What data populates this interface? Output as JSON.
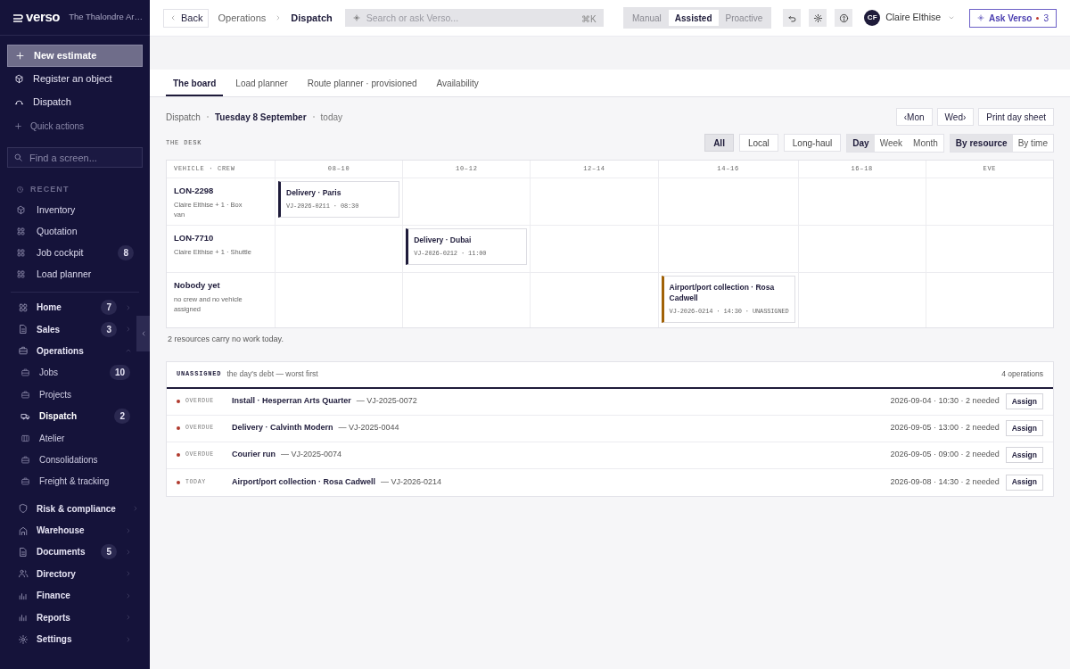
{
  "brand": {
    "logo": "verso",
    "org": "The Thalondre Ar…"
  },
  "quick_actions": [
    {
      "label": "New estimate",
      "selected": true
    },
    {
      "label": "Register an object",
      "selected": false
    },
    {
      "label": "Dispatch",
      "selected": false
    }
  ],
  "quick_actions_link": "Quick actions",
  "sidebar_search": {
    "placeholder": "Find a screen..."
  },
  "recent": {
    "heading": "RECENT",
    "items": [
      {
        "label": "Inventory"
      },
      {
        "label": "Quotation"
      },
      {
        "label": "Job cockpit",
        "count": "8"
      },
      {
        "label": "Load planner"
      }
    ]
  },
  "nav": [
    {
      "label": "Home",
      "count": "7",
      "expanded": false
    },
    {
      "label": "Sales",
      "count": "3",
      "expanded": false
    },
    {
      "label": "Operations",
      "expanded": true,
      "children": [
        {
          "label": "Jobs",
          "count": "10",
          "selected": false
        },
        {
          "label": "Projects",
          "selected": false
        },
        {
          "label": "Dispatch",
          "count": "2",
          "selected": true
        },
        {
          "label": "Atelier",
          "selected": false
        },
        {
          "label": "Consolidations",
          "selected": false
        },
        {
          "label": "Freight & tracking",
          "selected": false
        }
      ]
    },
    {
      "label": "Risk & compliance",
      "expanded": false
    },
    {
      "label": "Warehouse",
      "expanded": false
    },
    {
      "label": "Documents",
      "count": "5",
      "expanded": false
    },
    {
      "label": "Directory",
      "expanded": false
    },
    {
      "label": "Finance",
      "expanded": false
    },
    {
      "label": "Reports",
      "expanded": false
    },
    {
      "label": "Settings",
      "expanded": false
    }
  ],
  "topbar": {
    "back": "Back",
    "breadcrumb": [
      "Operations",
      "Dispatch"
    ],
    "search": {
      "placeholder": "Search or ask Verso...",
      "shortcut": "⌘K"
    },
    "modes": [
      {
        "label": "Manual",
        "selected": false
      },
      {
        "label": "Assisted",
        "selected": true
      },
      {
        "label": "Proactive",
        "selected": false
      }
    ],
    "user": {
      "initials": "CF",
      "name": "Claire Elthise"
    },
    "ask": {
      "label": "Ask Verso",
      "count": "3"
    }
  },
  "tabs": [
    {
      "label": "The board",
      "selected": true
    },
    {
      "label": "Load planner",
      "selected": false
    },
    {
      "label": "Route planner · provisioned",
      "selected": false
    },
    {
      "label": "Availability",
      "selected": false
    }
  ],
  "date_line": {
    "section": "Dispatch",
    "date": "Tuesday 8 September",
    "relative": "today"
  },
  "day_buttons": [
    "‹Mon",
    "Wed›",
    "Print day sheet"
  ],
  "desk_label": "THE DESK",
  "filter_groups": [
    {
      "kind": "separate",
      "options": [
        {
          "label": "All",
          "selected": true
        },
        {
          "label": "Local",
          "selected": false
        },
        {
          "label": "Long-haul",
          "selected": false
        }
      ]
    },
    {
      "kind": "joined",
      "options": [
        {
          "label": "Day",
          "selected": true
        },
        {
          "label": "Week",
          "selected": false
        },
        {
          "label": "Month",
          "selected": false
        }
      ]
    },
    {
      "kind": "joined",
      "options": [
        {
          "label": "By resource",
          "selected": true
        },
        {
          "label": "By time",
          "selected": false
        }
      ]
    }
  ],
  "board": {
    "resource_heading": "VEHICLE · CREW",
    "time_slots": [
      "08–10",
      "10–12",
      "12–14",
      "14–16",
      "16–18",
      "EVE"
    ],
    "rows": [
      {
        "title": "LON-2298",
        "subtitle": "Claire Elthise + 1 · Box van",
        "cells": [
          {
            "kind": "job",
            "title": "Delivery · Paris",
            "ref": "VJ-2026-0211 · 08:30",
            "color": "#1e1b3a"
          },
          {
            "kind": "empty"
          },
          {
            "kind": "empty"
          },
          {
            "kind": "empty"
          },
          {
            "kind": "empty"
          },
          {
            "kind": "empty"
          }
        ]
      },
      {
        "title": "LON-7710",
        "subtitle": "Claire Elthise + 1 · Shuttle",
        "cells": [
          {
            "kind": "empty"
          },
          {
            "kind": "job",
            "title": "Delivery · Dubai",
            "ref": "VJ-2026-0212 · 11:00",
            "color": "#1e1b3a"
          },
          {
            "kind": "empty"
          },
          {
            "kind": "empty"
          },
          {
            "kind": "empty"
          },
          {
            "kind": "empty"
          }
        ]
      },
      {
        "title": "Nobody yet",
        "subtitle": "no crew and no vehicle assigned",
        "cells": [
          {
            "kind": "empty"
          },
          {
            "kind": "empty"
          },
          {
            "kind": "empty"
          },
          {
            "kind": "job",
            "title": "Airport/port collection · Rosa Cadwell",
            "ref": "VJ-2026-0214 · 14:30 · UNASSIGNED",
            "color": "#a16207"
          },
          {
            "kind": "empty"
          },
          {
            "kind": "empty"
          }
        ]
      }
    ],
    "note": "2 resources carry no work today."
  },
  "unassigned": {
    "label": "UNASSIGNED",
    "caption": "the day's debt — worst first",
    "count": "4 operations",
    "rows": [
      {
        "status": "OVERDUE",
        "title": "Install · Hesperran Arts Quarter",
        "ref": "— VJ-2025-0072",
        "when": "2026-09-04 · 10:30 · 2 needed",
        "action": "Assign"
      },
      {
        "status": "OVERDUE",
        "title": "Delivery · Calvinth Modern",
        "ref": "— VJ-2025-0044",
        "when": "2026-09-05 · 13:00 · 2 needed",
        "action": "Assign"
      },
      {
        "status": "OVERDUE",
        "title": "Courier run",
        "ref": "— VJ-2025-0074",
        "when": "2026-09-05 · 09:00 · 2 needed",
        "action": "Assign"
      },
      {
        "status": "TODAY",
        "title": "Airport/port collection · Rosa Cadwell",
        "ref": "— VJ-2026-0214",
        "when": "2026-09-08 · 14:30 · 2 needed",
        "action": "Assign"
      }
    ]
  }
}
